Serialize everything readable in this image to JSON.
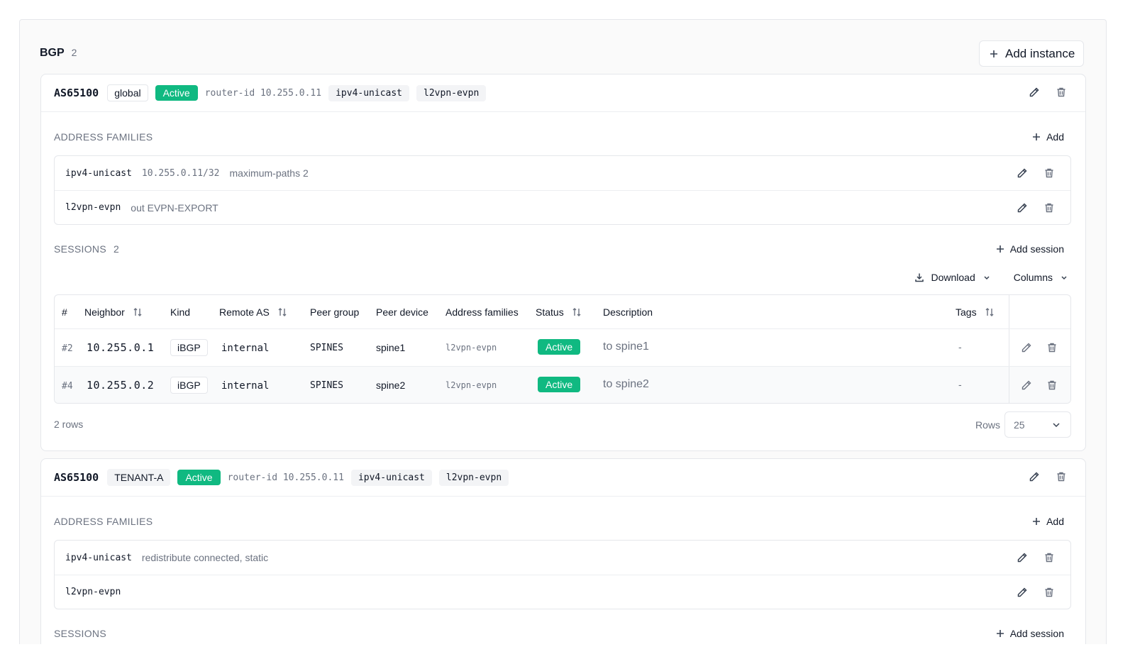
{
  "section": {
    "title": "BGP",
    "count": "2",
    "add_instance_label": "Add instance"
  },
  "instances": [
    {
      "asn": "AS65100",
      "vrf": "global",
      "status": "Active",
      "router_id": "router-id 10.255.0.11",
      "afs": [
        "ipv4-unicast",
        "l2vpn-evpn"
      ],
      "address_families": {
        "title": "ADDRESS FAMILIES",
        "add_label": "Add",
        "rows": [
          {
            "name": "ipv4-unicast",
            "detail_mono": "10.255.0.11/32",
            "detail": "maximum-paths 2"
          },
          {
            "name": "l2vpn-evpn",
            "detail": "out EVPN-EXPORT"
          }
        ]
      },
      "sessions": {
        "title": "SESSIONS",
        "count": "2",
        "add_label": "Add session",
        "download_label": "Download",
        "columns_label": "Columns",
        "headers": {
          "idx": "#",
          "neighbor": "Neighbor",
          "kind": "Kind",
          "remote_as": "Remote AS",
          "peer_group": "Peer group",
          "peer_device": "Peer device",
          "address_families": "Address families",
          "status": "Status",
          "description": "Description",
          "tags": "Tags"
        },
        "rows": [
          {
            "idx": "#2",
            "neighbor": "10.255.0.1",
            "kind": "iBGP",
            "remote_as": "internal",
            "peer_group": "SPINES",
            "peer_device": "spine1",
            "afs": "l2vpn-evpn",
            "status": "Active",
            "description": "to spine1",
            "tags": "-"
          },
          {
            "idx": "#4",
            "neighbor": "10.255.0.2",
            "kind": "iBGP",
            "remote_as": "internal",
            "peer_group": "SPINES",
            "peer_device": "spine2",
            "afs": "l2vpn-evpn",
            "status": "Active",
            "description": "to spine2",
            "tags": "-"
          }
        ],
        "rows_count": "2 rows",
        "rows_label": "Rows",
        "rows_per_page": "25"
      }
    },
    {
      "asn": "AS65100",
      "vrf": "TENANT-A",
      "status": "Active",
      "router_id": "router-id 10.255.0.11",
      "afs": [
        "ipv4-unicast",
        "l2vpn-evpn"
      ],
      "address_families": {
        "title": "ADDRESS FAMILIES",
        "add_label": "Add",
        "rows": [
          {
            "name": "ipv4-unicast",
            "detail": "redistribute connected, static"
          },
          {
            "name": "l2vpn-evpn"
          }
        ]
      },
      "sessions": {
        "title": "SESSIONS",
        "add_label": "Add session"
      }
    }
  ],
  "colors": {
    "accent_green": "#10b981",
    "border": "#e5e7eb",
    "muted_text": "#6b7280"
  }
}
